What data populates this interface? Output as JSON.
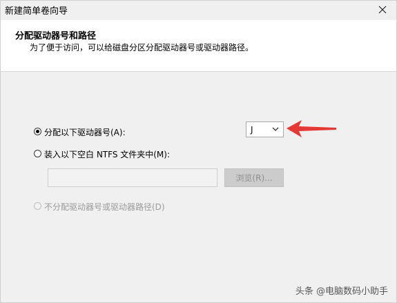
{
  "window": {
    "title": "新建简单卷向导"
  },
  "header": {
    "heading": "分配驱动器号和路径",
    "subheading": "为了便于访问，可以给磁盘分区分配驱动器号或驱动器路径。"
  },
  "options": {
    "assign_letter": {
      "label": "分配以下驱动器号(A):",
      "selected": true
    },
    "mount_folder": {
      "label": "装入以下空白 NTFS 文件夹中(M):",
      "selected": false
    },
    "no_assign": {
      "label": "不分配驱动器号或驱动器路径(D)",
      "selected": false,
      "disabled": true
    }
  },
  "drive_letter": {
    "value": "J"
  },
  "folder_path": {
    "value": ""
  },
  "browse_button": {
    "label": "浏览(R)..."
  },
  "watermark": {
    "text": "头条 @电脑数码小助手"
  },
  "colors": {
    "arrow": "#e53935"
  },
  "icons": {
    "close": "close-icon",
    "dropdown": "chevron-down-icon",
    "arrow": "arrow-left-icon"
  }
}
